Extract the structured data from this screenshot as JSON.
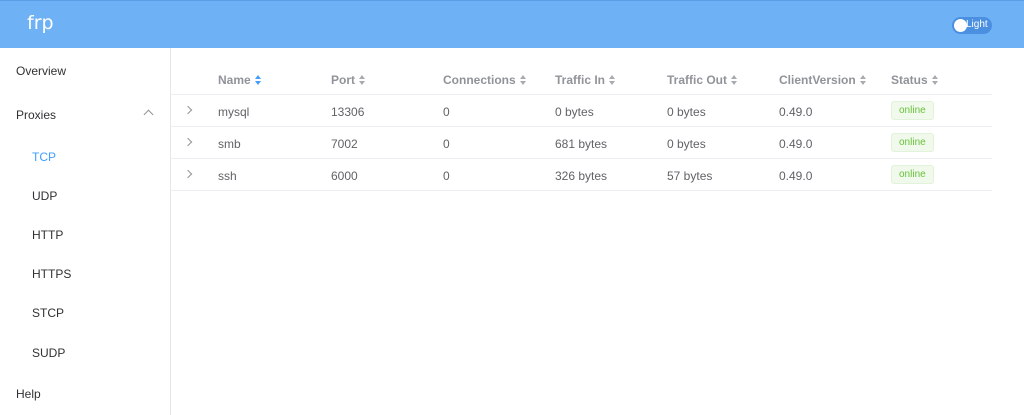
{
  "header": {
    "logo": "frp",
    "theme_label": "Light"
  },
  "sidebar": {
    "overview": "Overview",
    "proxies": "Proxies",
    "proxy_types": [
      "TCP",
      "UDP",
      "HTTP",
      "HTTPS",
      "STCP",
      "SUDP"
    ],
    "active": "TCP",
    "help": "Help"
  },
  "table": {
    "columns": [
      "Name",
      "Port",
      "Connections",
      "Traffic In",
      "Traffic Out",
      "ClientVersion",
      "Status"
    ],
    "sorted_column": "Name",
    "rows": [
      {
        "name": "mysql",
        "port": "13306",
        "connections": "0",
        "traffic_in": "0 bytes",
        "traffic_out": "0 bytes",
        "client_version": "0.49.0",
        "status": "online"
      },
      {
        "name": "smb",
        "port": "7002",
        "connections": "0",
        "traffic_in": "681 bytes",
        "traffic_out": "0 bytes",
        "client_version": "0.49.0",
        "status": "online"
      },
      {
        "name": "ssh",
        "port": "6000",
        "connections": "0",
        "traffic_in": "326 bytes",
        "traffic_out": "57 bytes",
        "client_version": "0.49.0",
        "status": "online"
      }
    ]
  },
  "colors": {
    "header_bg": "#6fb1f5",
    "accent": "#409eff",
    "online": "#67c23a"
  }
}
